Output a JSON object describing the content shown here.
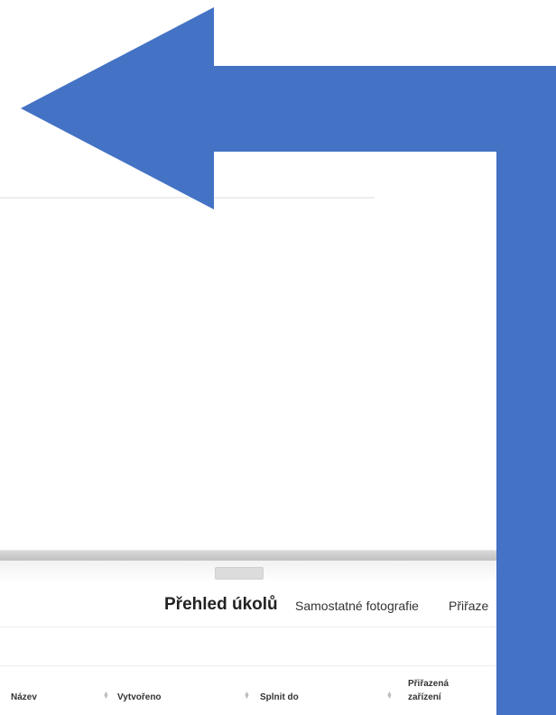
{
  "colors": {
    "arrow": "#4472C4",
    "text": "#222222",
    "divider": "#ececec",
    "splitter": "#c8c8c8"
  },
  "overlay": {
    "icon": "elbow-arrow-left-icon"
  },
  "tabs": [
    {
      "label": "Přehled úkolů",
      "active": true
    },
    {
      "label": "Samostatné fotografie",
      "active": false
    },
    {
      "label": "Přiřaze",
      "active": false
    }
  ],
  "table": {
    "columns": [
      {
        "label": "Název",
        "sort_icon": "sort-icon"
      },
      {
        "label": "Vytvořeno",
        "sort_icon": "sort-icon"
      },
      {
        "label": "Splnit do",
        "sort_icon": "sort-icon"
      },
      {
        "label_line1": "Přiřazená",
        "label_line2": "zařízení",
        "sort_icon": "sort-icon"
      }
    ]
  }
}
